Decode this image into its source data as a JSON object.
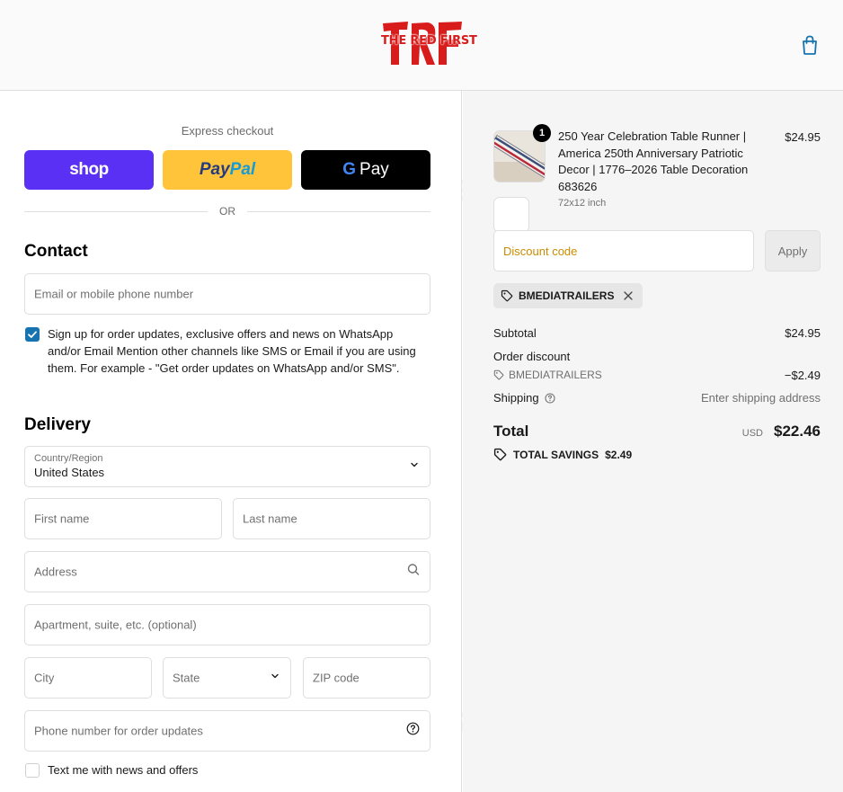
{
  "header": {
    "logo_text": "THE RED FIRST",
    "logo_letters": "TRF"
  },
  "express": {
    "title": "Express checkout",
    "shop_label": "shop",
    "paypal_label_1": "Pay",
    "paypal_label_2": "Pal",
    "gpay_g": "G",
    "gpay_label": "Pay",
    "or_label": "OR"
  },
  "contact": {
    "title": "Contact",
    "email_placeholder": "Email or mobile phone number",
    "signup_label": "Sign up for order updates, exclusive offers and news on WhatsApp and/or Email Mention other channels like SMS or Email if you are using them. For example - \"Get order updates on WhatsApp and/or SMS\".",
    "signup_checked": true
  },
  "delivery": {
    "title": "Delivery",
    "country_label": "Country/Region",
    "country_value": "United States",
    "first_name": "First name",
    "last_name": "Last name",
    "address": "Address",
    "apartment": "Apartment, suite, etc. (optional)",
    "city": "City",
    "state": "State",
    "zip": "ZIP code",
    "phone": "Phone number for order updates",
    "text_me_label": "Text me with news and offers",
    "text_me_checked": false
  },
  "order": {
    "quantity": "1",
    "product_title": "250 Year Celebration Table Runner | America 250th Anniversary Patriotic Decor | 1776–2026 Table Decoration 683626",
    "variant": "72x12 inch",
    "price": "$24.95",
    "discount_placeholder": "Discount code",
    "apply_label": "Apply",
    "code": "BMEDIATRAILERS",
    "subtotal_label": "Subtotal",
    "subtotal_value": "$24.95",
    "order_discount_label": "Order discount",
    "discount_code": "BMEDIATRAILERS",
    "discount_value": "−$2.49",
    "shipping_label": "Shipping",
    "shipping_value": "Enter shipping address",
    "total_label": "Total",
    "currency": "USD",
    "total_value": "$22.46",
    "savings_label": "TOTAL SAVINGS",
    "savings_value": "$2.49"
  },
  "colors": {
    "accent": "#1773b0",
    "shop": "#5a31f4",
    "paypal": "#ffc439",
    "logo_red": "#d81b1b"
  }
}
